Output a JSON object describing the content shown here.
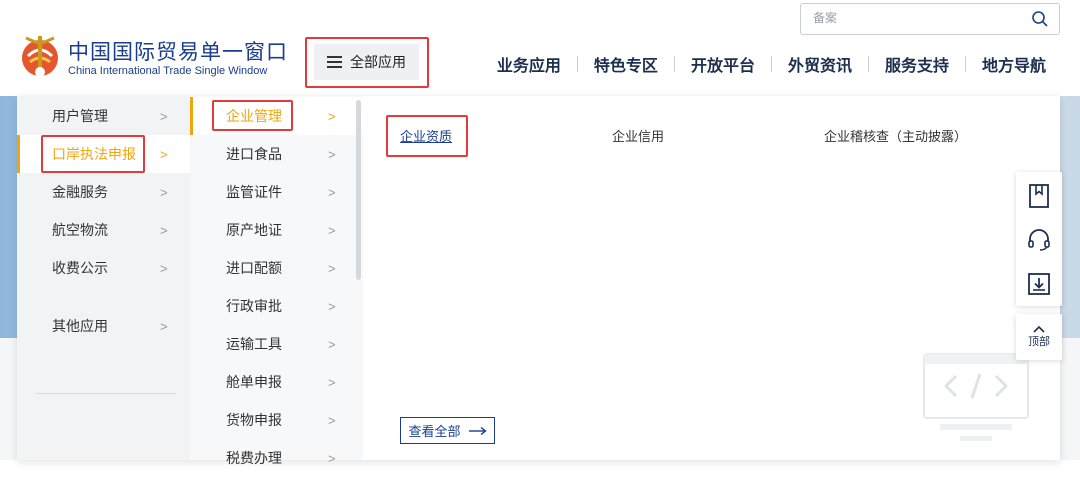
{
  "header": {
    "brand_cn": "中国国际贸易单一窗口",
    "brand_en": "China International Trade Single Window",
    "all_apps_label": "全部应用",
    "search_placeholder": "备案",
    "nav": [
      "业务应用",
      "特色专区",
      "开放平台",
      "外贸资讯",
      "服务支持",
      "地方导航"
    ]
  },
  "menu": {
    "col1": [
      "用户管理",
      "口岸执法申报",
      "金融服务",
      "航空物流",
      "收费公示",
      "其他应用"
    ],
    "col1_active": "口岸执法申报",
    "col2": [
      "企业管理",
      "进口食品",
      "监管证件",
      "原产地证",
      "进口配额",
      "行政审批",
      "运输工具",
      "舱单申报",
      "货物申报",
      "税费办理"
    ],
    "col2_active": "企业管理",
    "col3": [
      "企业资质",
      "企业信用",
      "企业稽核查（主动披露）"
    ],
    "col3_active": "企业资质",
    "view_all": "查看全部"
  },
  "float_toolbar": {
    "icons": [
      "bookmark-icon",
      "headset-icon",
      "download-icon"
    ],
    "top_label": "顶部"
  },
  "colors": {
    "accent": "#f0a50c",
    "brand": "#1a3d8f",
    "highlight_box": "#e23b3b"
  }
}
